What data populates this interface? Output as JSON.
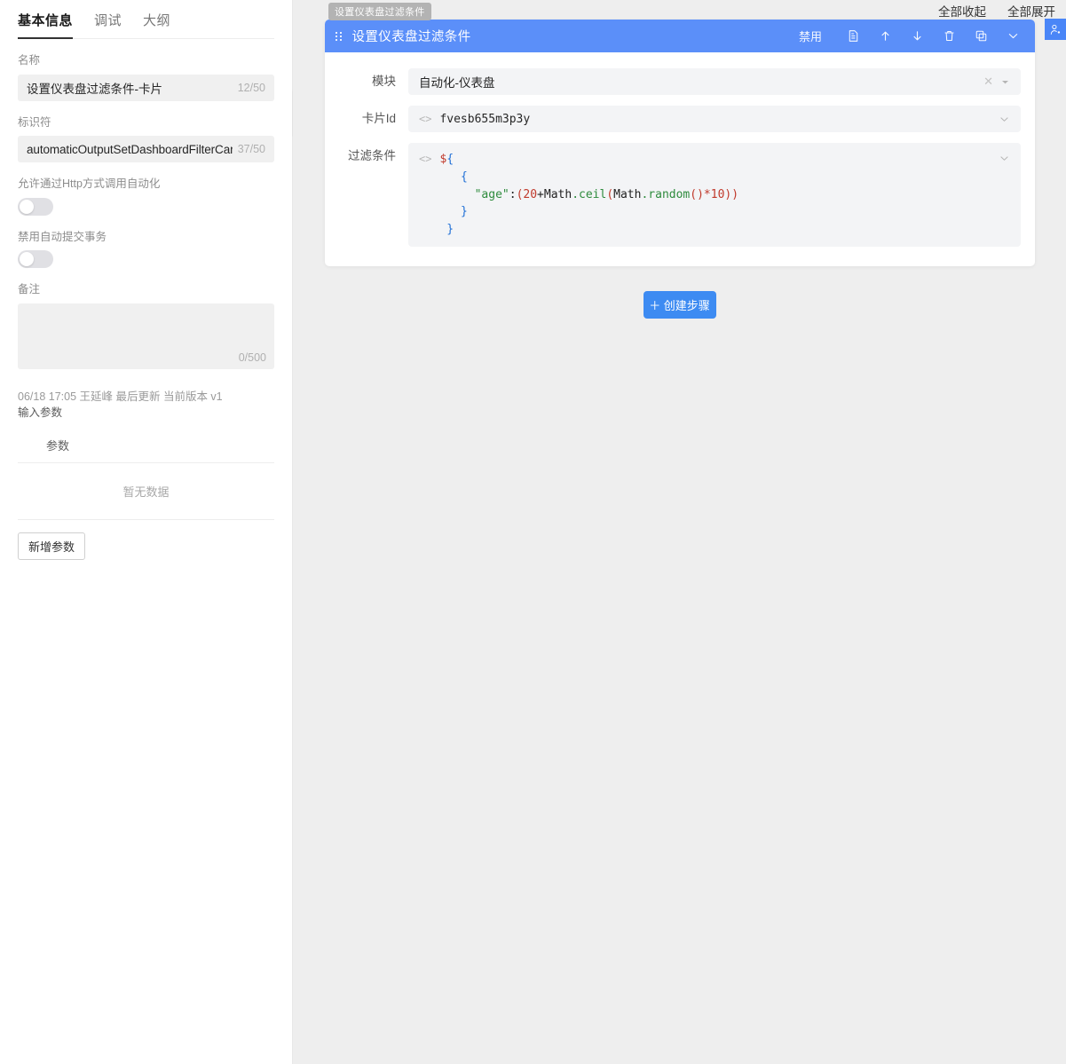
{
  "sidebar": {
    "tabs": [
      {
        "label": "基本信息",
        "active": true
      },
      {
        "label": "调试",
        "active": false
      },
      {
        "label": "大纲",
        "active": false
      }
    ],
    "name_field": {
      "label": "名称",
      "value": "设置仪表盘过滤条件-卡片",
      "counter": "12/50"
    },
    "ident_field": {
      "label": "标识符",
      "value": "automaticOutputSetDashboardFilterCard",
      "counter": "37/50"
    },
    "http_toggle": {
      "label": "允许通过Http方式调用自动化",
      "state": "off"
    },
    "txn_toggle": {
      "label": "禁用自动提交事务",
      "state": "off"
    },
    "remark_field": {
      "label": "备注",
      "value": "",
      "counter": "0/500"
    },
    "meta": "06/18 17:05 王延峰 最后更新 当前版本 v1",
    "input_params_title": "输入参数",
    "param_table": {
      "header": "参数",
      "empty_text": "暂无数据"
    },
    "add_param_button": "新增参数",
    "collapse_handle_icon": "caret-left-icon"
  },
  "main": {
    "top_actions": [
      {
        "label": "全部收起",
        "name": "collapse-all"
      },
      {
        "label": "全部展开",
        "name": "expand-all"
      }
    ],
    "user_button_icon": "add-user-icon",
    "node_tooltip": "设置仪表盘过滤条件",
    "card": {
      "title": "设置仪表盘过滤条件",
      "drag_handle_icon": "drag-dots-icon",
      "disable_label": "禁用",
      "toolbar_icons": [
        "note-icon",
        "arrow-up-icon",
        "arrow-down-icon",
        "trash-icon",
        "copy-icon",
        "chevron-down-icon"
      ],
      "rows": [
        {
          "label": "模块",
          "type": "select",
          "value": "自动化-仪表盘",
          "clear_icon": "close-icon",
          "chevron_icon": "caret-down-icon"
        },
        {
          "label": "卡片Id",
          "type": "code-input",
          "value": "fvesb655m3p3y",
          "code_icon": "angle-brackets-icon",
          "chevron_icon": "chevron-down-icon"
        },
        {
          "label": "过滤条件",
          "type": "code-block",
          "code_icon": "angle-brackets-icon",
          "chevron_icon": "chevron-down-icon",
          "code_lines": [
            "${",
            "   {",
            "     \"age\":(20+Math.ceil(Math.random()*10))",
            "   }",
            " }"
          ]
        }
      ]
    },
    "create_step_button": "＋ 创建步骤"
  },
  "colors": {
    "accent_blue": "#5b8ff9",
    "button_blue": "#3d8bf2",
    "panel_bg": "#eeeeee",
    "input_bg": "#f0f0f0",
    "control_bg": "#f3f4f6",
    "string_green": "#2e8b3d",
    "number_red": "#c0392b",
    "brace_blue": "#1f6fd6"
  }
}
